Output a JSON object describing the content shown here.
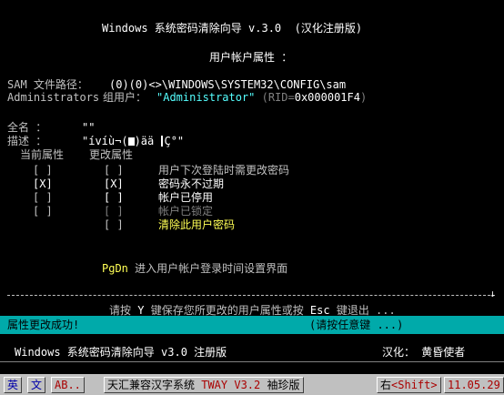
{
  "title": "Windows 系统密码清除向导 v.3.0  (汉化注册版)",
  "subtitle": "用户帐户属性 ：",
  "sam": {
    "label": "SAM 文件路径：",
    "value": "(0)(0)<>\\WINDOWS\\SYSTEM32\\CONFIG\\sam"
  },
  "group": {
    "name": "Administrators",
    "label": "组用户：",
    "user": "\"Administrator\"",
    "rid_label": " (RID=",
    "rid_value": "0x000001F4",
    "rid_close": ")"
  },
  "fullname": {
    "label": "全名 ：",
    "value": "\"\""
  },
  "description": {
    "label": "描述 ：",
    "value_part1": "\"ívíù¬(",
    "value_part2": ")ää ",
    "value_part3": "Ç°\""
  },
  "columns": {
    "current": "当前属性",
    "change": "更改属性"
  },
  "properties": [
    {
      "current": "[ ]",
      "change": "[ ]",
      "label": "用户下次登陆时需更改密码"
    },
    {
      "current": "[X]",
      "change": "[X]",
      "label": "密码永不过期"
    },
    {
      "current": "[ ]",
      "change": "[ ]",
      "label": "帐户已停用"
    },
    {
      "current": "[ ]",
      "change": "[ ]",
      "label": "帐户已锁定"
    },
    {
      "current": "",
      "change": "[ ]",
      "label": "清除此用户密码"
    }
  ],
  "pgdn": {
    "key": "PgDn",
    "text": " 进入用户帐户登录时间设置界面"
  },
  "instructions": {
    "part1": "请按 ",
    "key_y": "Y",
    "part2": " 键保存您所更改的用户属性或按 ",
    "key_esc": "Esc",
    "part3": " 键退出 ..."
  },
  "status": {
    "message": "属性更改成功!",
    "hint": "(请按任意键 ...)"
  },
  "footer": {
    "app": "Windows 系统密码清除向导 v3.0 注册版",
    "credit": "汉化： 黄昏使者"
  },
  "ime": {
    "mode1": "英",
    "mode2": "文",
    "input": "AB..",
    "system": "天汇兼容汉字系统 ",
    "version": "TWAY V3.2",
    "edition": " 袖珍版",
    "shift_prefix": "右",
    "shift_key": "<Shift>",
    "date": "11.05.29"
  },
  "colors": {
    "cyan": "#55ffff",
    "yellow": "#ffff55",
    "status_bg": "#00aaaa",
    "ime_bg": "#c0c0c0"
  }
}
